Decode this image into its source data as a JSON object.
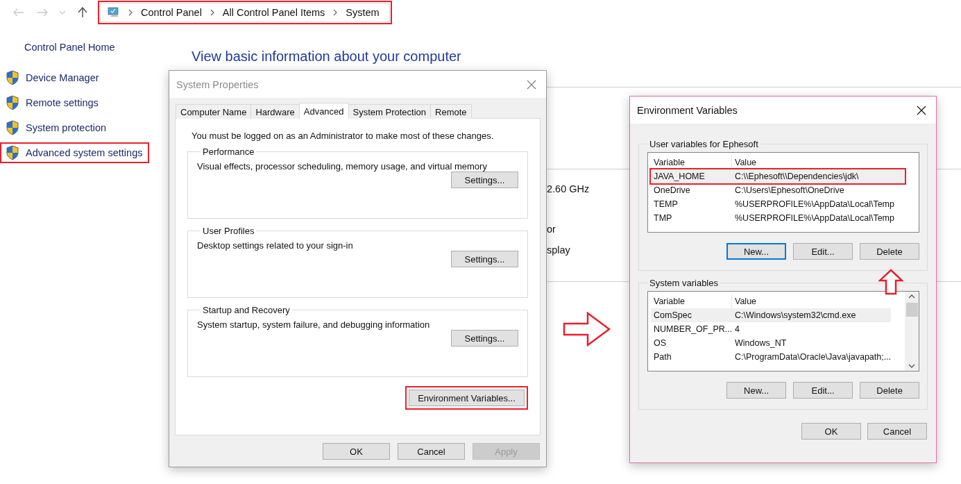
{
  "address_bar": {
    "crumbs": [
      "Control Panel",
      "All Control Panel Items",
      "System"
    ],
    "highlighted": true
  },
  "sidebar": {
    "home_link": "Control Panel Home",
    "items": [
      {
        "label": "Device Manager",
        "highlighted": false
      },
      {
        "label": "Remote settings",
        "highlighted": false
      },
      {
        "label": "System protection",
        "highlighted": false
      },
      {
        "label": "Advanced system settings",
        "highlighted": true
      }
    ]
  },
  "main": {
    "heading": "View basic information about your computer",
    "fragments": [
      "2.60 GHz",
      "or",
      "splay"
    ]
  },
  "system_properties": {
    "title": "System Properties",
    "tabs": [
      {
        "label": "Computer Name",
        "selected": false
      },
      {
        "label": "Hardware",
        "selected": false
      },
      {
        "label": "Advanced",
        "selected": true
      },
      {
        "label": "System Protection",
        "selected": false
      },
      {
        "label": "Remote",
        "selected": false
      }
    ],
    "notice": "You must be logged on as an Administrator to make most of these changes.",
    "groups": [
      {
        "title": "Performance",
        "description": "Visual effects, processor scheduling, memory usage, and virtual memory",
        "button": "Settings..."
      },
      {
        "title": "User Profiles",
        "description": "Desktop settings related to your sign-in",
        "button": "Settings..."
      },
      {
        "title": "Startup and Recovery",
        "description": "System startup, system failure, and debugging information",
        "button": "Settings..."
      }
    ],
    "env_button": {
      "label": "Environment Variables...",
      "highlighted": true
    },
    "buttons": [
      {
        "label": "OK",
        "disabled": false
      },
      {
        "label": "Cancel",
        "disabled": false
      },
      {
        "label": "Apply",
        "disabled": true
      }
    ]
  },
  "environment_variables": {
    "title": "Environment Variables",
    "sections": [
      {
        "title": "User variables for Ephesoft",
        "columns": [
          "Variable",
          "Value"
        ],
        "scrollable": false,
        "rows": [
          {
            "variable": "JAVA_HOME",
            "value": "C:\\\\Ephesoft\\\\Dependencies\\jdk\\",
            "selected": true,
            "highlighted": true
          },
          {
            "variable": "OneDrive",
            "value": "C:\\Users\\Ephesoft\\OneDrive",
            "selected": false,
            "highlighted": false
          },
          {
            "variable": "TEMP",
            "value": "%USERPROFILE%\\AppData\\Local\\Temp",
            "selected": false,
            "highlighted": false
          },
          {
            "variable": "TMP",
            "value": "%USERPROFILE%\\AppData\\Local\\Temp",
            "selected": false,
            "highlighted": false
          }
        ],
        "buttons": [
          {
            "label": "New...",
            "focused": true
          },
          {
            "label": "Edit...",
            "focused": false
          },
          {
            "label": "Delete",
            "focused": false
          }
        ]
      },
      {
        "title": "System variables",
        "columns": [
          "Variable",
          "Value"
        ],
        "scrollable": true,
        "rows": [
          {
            "variable": "ComSpec",
            "value": "C:\\Windows\\system32\\cmd.exe",
            "selected": true,
            "highlighted": false
          },
          {
            "variable": "NUMBER_OF_PR...",
            "value": "4",
            "selected": false,
            "highlighted": false
          },
          {
            "variable": "OS",
            "value": "Windows_NT",
            "selected": false,
            "highlighted": false
          },
          {
            "variable": "Path",
            "value": "C:\\ProgramData\\Oracle\\Java\\javapath;...",
            "selected": false,
            "highlighted": false
          }
        ],
        "buttons": [
          {
            "label": "New...",
            "focused": false
          },
          {
            "label": "Edit...",
            "focused": false
          },
          {
            "label": "Delete",
            "focused": false
          }
        ]
      }
    ],
    "buttons": [
      {
        "label": "OK",
        "focused": false
      },
      {
        "label": "Cancel",
        "focused": false
      }
    ]
  }
}
